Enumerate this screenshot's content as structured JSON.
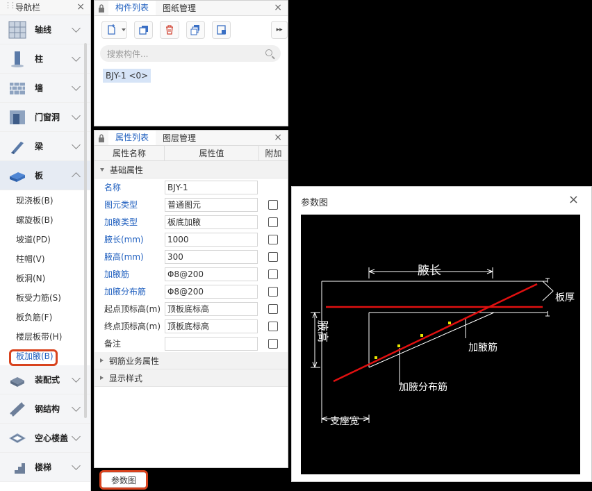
{
  "nav": {
    "title": "导航栏",
    "categories": [
      {
        "label": "轴线",
        "icon": "grid-axis-icon"
      },
      {
        "label": "柱",
        "icon": "column-icon"
      },
      {
        "label": "墙",
        "icon": "wall-icon"
      },
      {
        "label": "门窗洞",
        "icon": "door-window-icon"
      },
      {
        "label": "梁",
        "icon": "beam-icon"
      },
      {
        "label": "板",
        "icon": "slab-icon"
      }
    ],
    "slab_items": [
      "现浇板(B)",
      "螺旋板(B)",
      "坡道(PD)",
      "柱帽(V)",
      "板洞(N)",
      "板受力筋(S)",
      "板负筋(F)",
      "楼层板带(H)",
      "板加腋(B)"
    ],
    "more_categories": [
      {
        "label": "装配式",
        "icon": "prefab-icon"
      },
      {
        "label": "钢结构",
        "icon": "steel-icon"
      },
      {
        "label": "空心楼盖",
        "icon": "hollow-floor-icon"
      },
      {
        "label": "楼梯",
        "icon": "stair-icon"
      }
    ]
  },
  "component_panel": {
    "tabs": [
      "构件列表",
      "图纸管理"
    ],
    "search_placeholder": "搜索构件...",
    "chip": "BJY-1 <0>"
  },
  "property_panel": {
    "tabs": [
      "属性列表",
      "图层管理"
    ],
    "headers": [
      "属性名称",
      "属性值",
      "附加"
    ],
    "group_basic": "基础属性",
    "rows": [
      {
        "name": "名称",
        "value": "BJY-1",
        "blue": true,
        "checkbox": false
      },
      {
        "name": "图元类型",
        "value": "普通图元",
        "blue": true,
        "checkbox": true
      },
      {
        "name": "加腋类型",
        "value": "板底加腋",
        "blue": true,
        "checkbox": true
      },
      {
        "name": "腋长(mm)",
        "value": "1000",
        "blue": true,
        "checkbox": true
      },
      {
        "name": "腋高(mm)",
        "value": "300",
        "blue": true,
        "checkbox": true
      },
      {
        "name": "加腋筋",
        "value": "Φ8@200",
        "blue": true,
        "checkbox": true
      },
      {
        "name": "加腋分布筋",
        "value": "Φ8@200",
        "blue": true,
        "checkbox": true
      },
      {
        "name": "起点顶标高(m)",
        "value": "顶板底标高",
        "blue": false,
        "checkbox": true
      },
      {
        "name": "终点顶标高(m)",
        "value": "顶板底标高",
        "blue": false,
        "checkbox": true
      },
      {
        "name": "备注",
        "value": "",
        "blue": false,
        "checkbox": true
      }
    ],
    "group_rebar": "钢筋业务属性",
    "group_display": "显示样式"
  },
  "bottom_button": "参数图",
  "dialog": {
    "title": "参数图",
    "labels": {
      "haunch_length": "腋长",
      "slab_thickness": "板厚",
      "haunch_height": "腋高",
      "haunch_rebar": "加腋筋",
      "distribution_rebar": "加腋分布筋",
      "support_width": "支座宽"
    }
  },
  "colors": {
    "accent": "#1f5fbf",
    "highlight": "#d8431e",
    "rebar": "#e01010"
  }
}
